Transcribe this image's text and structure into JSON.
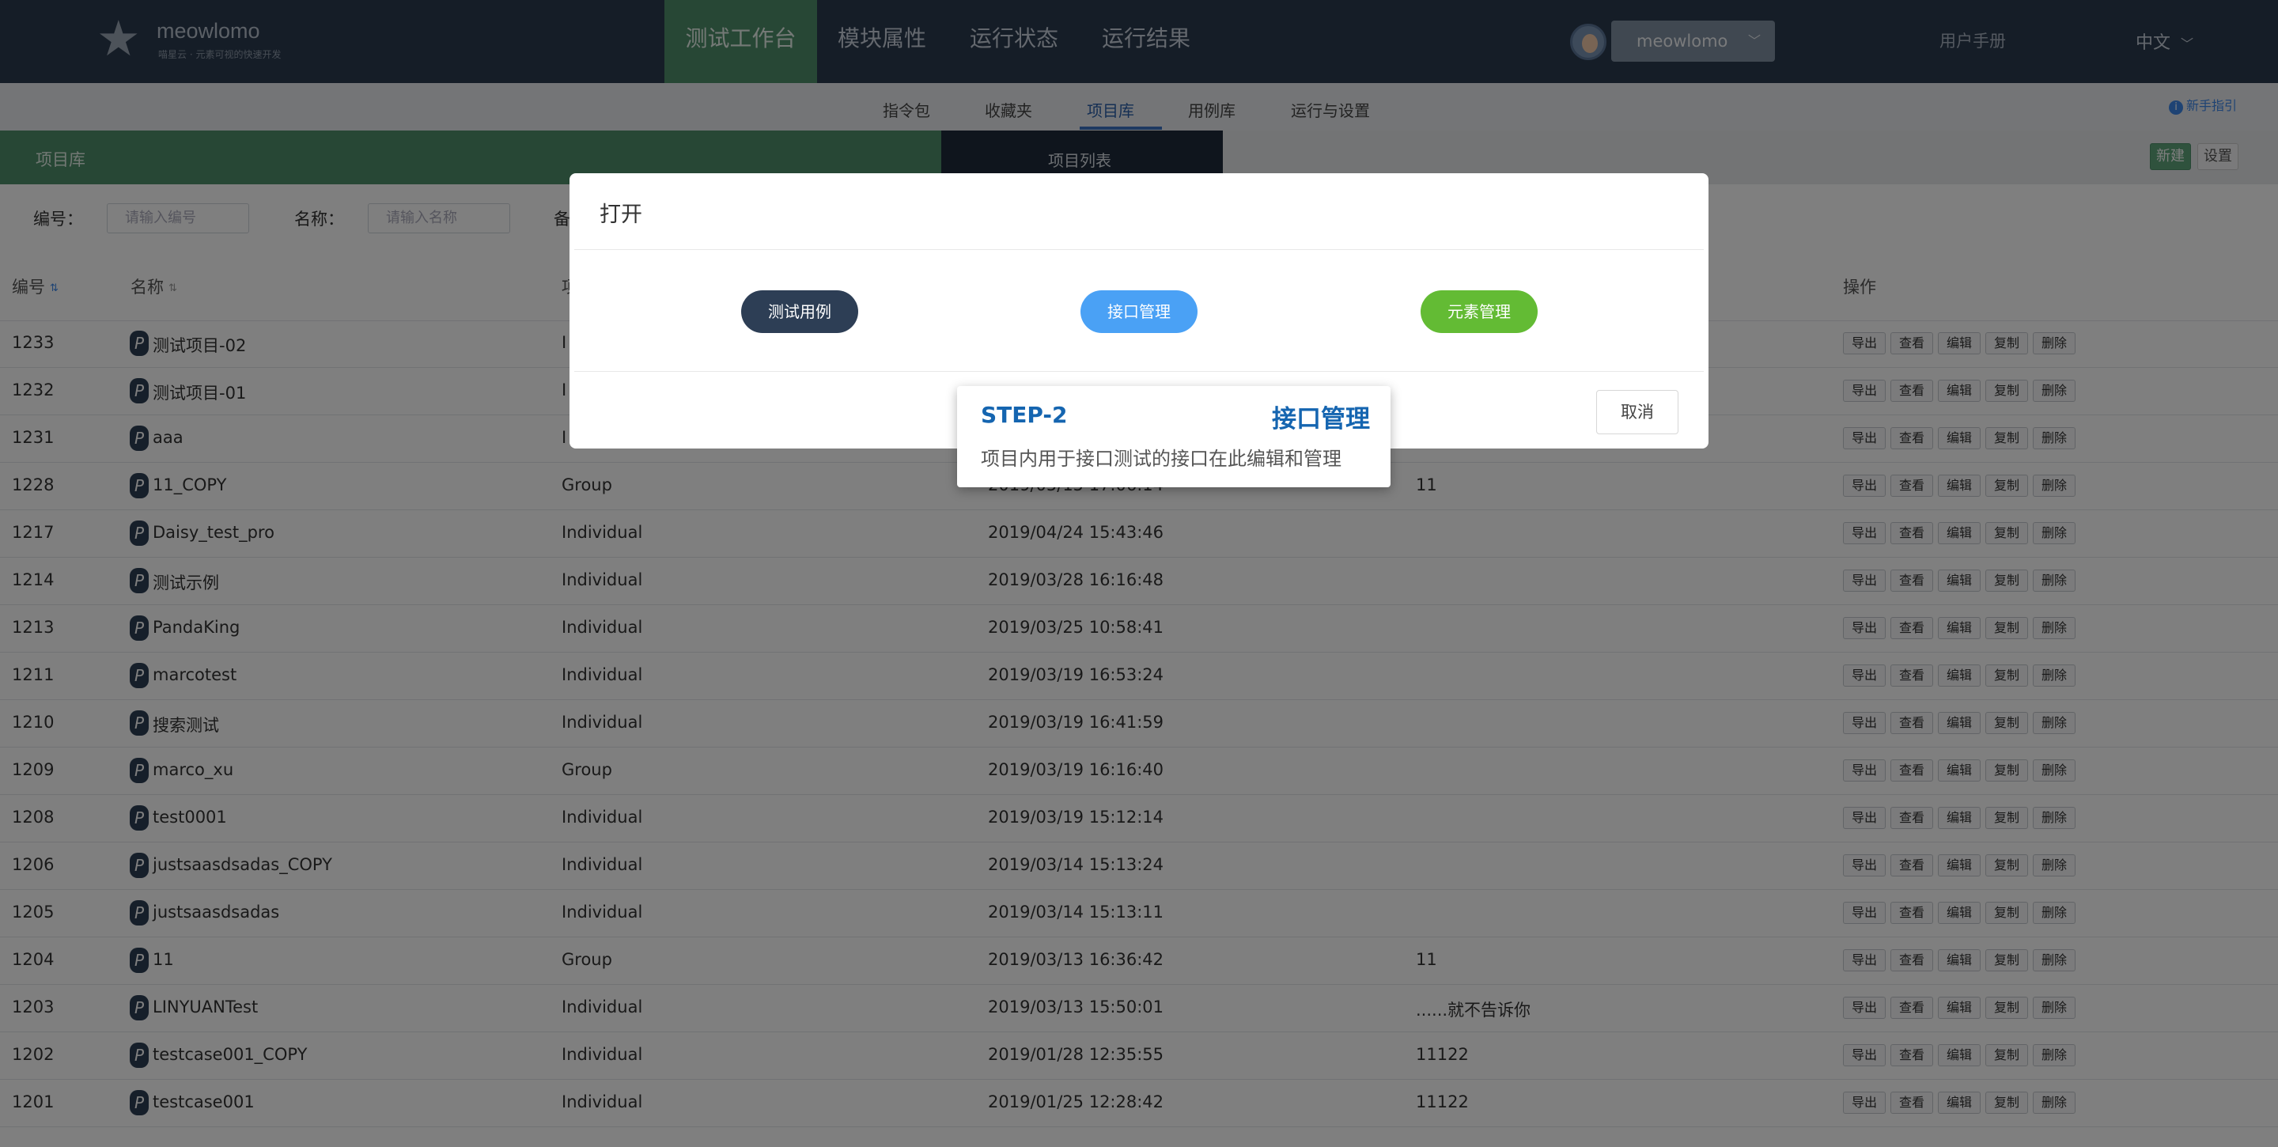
{
  "brand": {
    "name": "meowlomo",
    "subtitle": "喵星云 · 元素可视的快速开发"
  },
  "nav": {
    "tabs": [
      "测试工作台",
      "模块属性",
      "运行状态",
      "运行结果"
    ],
    "user": "meowlomo",
    "manual": "用户手册",
    "language": "中文"
  },
  "subnav": {
    "tabs": [
      "指令包",
      "收藏夹",
      "项目库",
      "用例库",
      "运行与设置"
    ],
    "active": "项目库",
    "guide": "新手指引"
  },
  "band": {
    "title": "项目库",
    "list_tab": "项目列表",
    "new_label": "新建",
    "settings_label": "设置"
  },
  "filters": {
    "id_label": "编号：",
    "id_placeholder": "请输入编号",
    "name_label": "名称：",
    "name_placeholder": "请输入名称",
    "remark_label": "备"
  },
  "table": {
    "headers": {
      "id": "编号",
      "name": "名称",
      "type": "项",
      "ops": "操作"
    },
    "ops": [
      "导出",
      "查看",
      "编辑",
      "复制",
      "删除"
    ],
    "rows": [
      {
        "id": "1233",
        "name": "测试项目-02",
        "type": "I",
        "date": "",
        "remark": ""
      },
      {
        "id": "1232",
        "name": "测试项目-01",
        "type": "I",
        "date": "",
        "remark": ""
      },
      {
        "id": "1231",
        "name": "aaa",
        "type": "I",
        "date": "",
        "remark": ""
      },
      {
        "id": "1228",
        "name": "11_COPY",
        "type": "Group",
        "date": "2019/05/15 17:06:14",
        "remark": "11"
      },
      {
        "id": "1217",
        "name": "Daisy_test_pro",
        "type": "Individual",
        "date": "2019/04/24 15:43:46",
        "remark": ""
      },
      {
        "id": "1214",
        "name": "测试示例",
        "type": "Individual",
        "date": "2019/03/28 16:16:48",
        "remark": ""
      },
      {
        "id": "1213",
        "name": "PandaKing",
        "type": "Individual",
        "date": "2019/03/25 10:58:41",
        "remark": ""
      },
      {
        "id": "1211",
        "name": "marcotest",
        "type": "Individual",
        "date": "2019/03/19 16:53:24",
        "remark": ""
      },
      {
        "id": "1210",
        "name": "搜索测试",
        "type": "Individual",
        "date": "2019/03/19 16:41:59",
        "remark": ""
      },
      {
        "id": "1209",
        "name": "marco_xu",
        "type": "Group",
        "date": "2019/03/19 16:16:40",
        "remark": ""
      },
      {
        "id": "1208",
        "name": "test0001",
        "type": "Individual",
        "date": "2019/03/19 15:12:14",
        "remark": ""
      },
      {
        "id": "1206",
        "name": "justsaasdsadas_COPY",
        "type": "Individual",
        "date": "2019/03/14 15:13:24",
        "remark": ""
      },
      {
        "id": "1205",
        "name": "justsaasdsadas",
        "type": "Individual",
        "date": "2019/03/14 15:13:11",
        "remark": ""
      },
      {
        "id": "1204",
        "name": "11",
        "type": "Group",
        "date": "2019/03/13 16:36:42",
        "remark": "11"
      },
      {
        "id": "1203",
        "name": "LINYUANTest",
        "type": "Individual",
        "date": "2019/03/13 15:50:01",
        "remark": "......就不告诉你"
      },
      {
        "id": "1202",
        "name": "testcase001_COPY",
        "type": "Individual",
        "date": "2019/01/28 12:35:55",
        "remark": "11122"
      },
      {
        "id": "1201",
        "name": "testcase001",
        "type": "Individual",
        "date": "2019/01/25 12:28:42",
        "remark": "11122"
      }
    ]
  },
  "modal": {
    "title": "打开",
    "options": [
      "测试用例",
      "接口管理",
      "元素管理"
    ],
    "cancel_label": "取消"
  },
  "tooltip": {
    "step": "STEP-2",
    "name": "接口管理",
    "desc": "项目内用于接口测试的接口在此编辑和管理"
  },
  "colors": {
    "nav_bg": "#2b3a4e",
    "active_green": "#4f8f6b",
    "accent_blue": "#4aa1f5",
    "element_green": "#63bb34",
    "step_blue": "#1565b0"
  }
}
